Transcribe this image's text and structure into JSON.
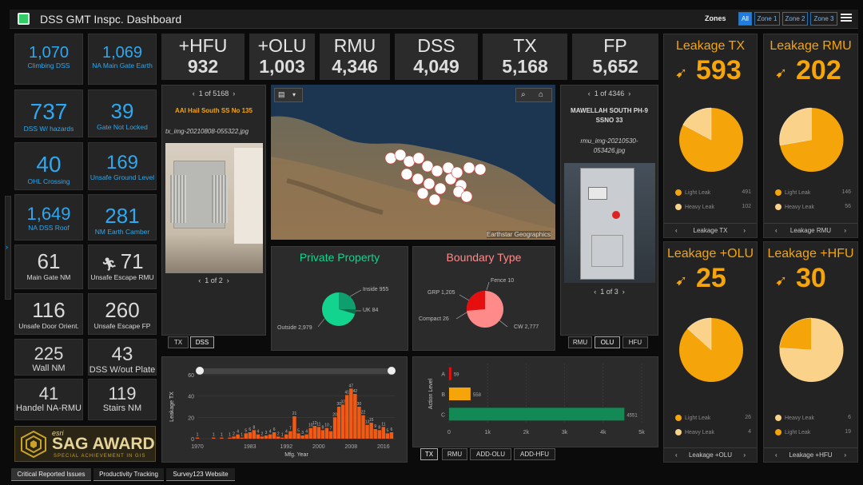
{
  "header": {
    "title": "DSS GMT Inspc. Dashboard",
    "zones_label": "Zones",
    "zones": [
      "All",
      "Zone 1",
      "Zone 2",
      "Zone 3"
    ]
  },
  "kpis": [
    {
      "value": "1,070",
      "label": "Climbing DSS"
    },
    {
      "value": "1,069",
      "label": "NA Main Gate Earth"
    },
    {
      "value": "737",
      "label": "DSS W/ hazards"
    },
    {
      "value": "39",
      "label": "Gate Not Locked"
    },
    {
      "value": "40",
      "label": "OHL Crossing"
    },
    {
      "value": "169",
      "label": "Unsafe Ground Level"
    },
    {
      "value": "1,649",
      "label": "NA DSS Roof"
    },
    {
      "value": "281",
      "label": "NM Earth Camber"
    },
    {
      "value": "61",
      "label": "Main Gate NM"
    },
    {
      "value": "71",
      "label": "Unsafe Escape RMU"
    },
    {
      "value": "116",
      "label": "Unsafe Door Orient."
    },
    {
      "value": "260",
      "label": "Unsafe Escape FP"
    },
    {
      "value": "225",
      "label": "Wall NM"
    },
    {
      "value": "43",
      "label": "DSS W/out Plate"
    },
    {
      "value": "41",
      "label": "Handel NA-RMU"
    },
    {
      "value": "119",
      "label": "Stairs NM"
    }
  ],
  "award": {
    "brand": "esri",
    "title": "SAG AWARD",
    "subtitle": "SPECIAL ACHIEVEMENT IN GIS"
  },
  "totals": [
    {
      "label": "+HFU",
      "value": "932"
    },
    {
      "label": "+OLU",
      "value": "1,003"
    },
    {
      "label": "RMU",
      "value": "4,346"
    },
    {
      "label": "DSS",
      "value": "4,049"
    },
    {
      "label": "TX",
      "value": "5,168"
    },
    {
      "label": "FP",
      "value": "5,652"
    }
  ],
  "left_viewer": {
    "pager": "1 of 5168",
    "site": "AAI Hail South SS No 135",
    "file": "tx_img-20210808-055322.jpg",
    "img_pager": "1 of 2",
    "tabs": [
      "TX",
      "DSS"
    ]
  },
  "right_viewer": {
    "pager": "1 of 4346",
    "site": "MAWELLAH SOUTH PH-9 SSNO 33",
    "file": "rmu_img-20210530-053426.jpg",
    "img_pager": "1 of 3",
    "tabs": [
      "RMU",
      "OLU",
      "HFU"
    ]
  },
  "map": {
    "attribution": "Earthstar Geographics"
  },
  "private_property": {
    "title": "Private Property",
    "labels": [
      "Inside 955",
      "UK 84",
      "Outside 2,979"
    ],
    "colors": [
      "#13d48e",
      "#0f9e6d",
      "#2ab78a"
    ]
  },
  "boundary_type": {
    "title": "Boundary Type",
    "labels": [
      "Fence 10",
      "GRP 1,205",
      "Compact 26",
      "CW 2,777"
    ],
    "colors": [
      "#ff8a8a",
      "#e60f0f"
    ]
  },
  "leakage": [
    {
      "title": "Leakage TX",
      "value": "593",
      "items": [
        {
          "name": "Light Leak",
          "count": "491"
        },
        {
          "name": "Heavy Leak",
          "count": "102"
        }
      ],
      "footer": "Leakage TX"
    },
    {
      "title": "Leakage RMU",
      "value": "202",
      "items": [
        {
          "name": "Light Leak",
          "count": "146"
        },
        {
          "name": "Heavy Leak",
          "count": "56"
        }
      ],
      "footer": "Leakage RMU"
    },
    {
      "title": "Leakage +OLU",
      "value": "25",
      "items": [
        {
          "name": "Light Leak",
          "count": "26"
        },
        {
          "name": "Heavy Leak",
          "count": "4"
        }
      ],
      "footer": "Leakage +OLU"
    },
    {
      "title": "Leakage +HFU",
      "value": "30",
      "items": [
        {
          "name": "Heavy Leak",
          "count": "6"
        },
        {
          "name": "Light Leak",
          "count": "19"
        }
      ],
      "footer": "Leakage +HFU"
    }
  ],
  "colors": {
    "orange": "#f5a40a",
    "light": "#fbd28a",
    "blue": "#2ea8f0",
    "bar": "#f05a14",
    "green": "#138a55"
  },
  "chart_data": [
    {
      "type": "bar",
      "ylabel": "Leakage TX",
      "xlabel": "Mfg. Year",
      "x": [
        1970,
        1974,
        1976,
        1978,
        1979,
        1980,
        1981,
        1982,
        1983,
        1984,
        1985,
        1986,
        1987,
        1988,
        1989,
        1990,
        1991,
        1992,
        1993,
        1994,
        1995,
        1996,
        1997,
        1998,
        1999,
        2000,
        2001,
        2002,
        2003,
        2004,
        2005,
        2006,
        2007,
        2008,
        2009,
        2010,
        2011,
        2012,
        2013,
        2014,
        2015,
        2016,
        2017,
        2018
      ],
      "values": [
        1,
        1,
        1,
        1,
        2,
        4,
        1,
        5,
        6,
        8,
        4,
        2,
        3,
        4,
        6,
        2,
        1,
        4,
        7,
        21,
        5,
        3,
        4,
        10,
        12,
        11,
        8,
        10,
        7,
        20,
        30,
        32,
        41,
        47,
        42,
        30,
        22,
        13,
        15,
        9,
        8,
        11,
        5,
        6
      ],
      "x_ticks": [
        "1970",
        "1983",
        "1992",
        "2000",
        "2008",
        "2016"
      ],
      "y_ticks": [
        "0",
        "20",
        "40",
        "60"
      ],
      "ylim": [
        0,
        60
      ]
    },
    {
      "type": "bar",
      "orientation": "horizontal",
      "ylabel": "Action Level",
      "categories": [
        "A",
        "B",
        "C"
      ],
      "values": [
        59,
        558,
        4551
      ],
      "x_ticks": [
        "0",
        "1k",
        "2k",
        "3k",
        "4k",
        "5k"
      ],
      "xlim": [
        0,
        5000
      ],
      "bar_colors": [
        "#e60f0f",
        "#f5a40a",
        "#138a55"
      ],
      "tabs": [
        "TX",
        "RMU",
        "ADD-OLU",
        "ADD-HFU"
      ]
    }
  ],
  "bottom_tabs": [
    "Critical Reported Issues",
    "Productivity Tracking",
    "Survey123 Website"
  ]
}
